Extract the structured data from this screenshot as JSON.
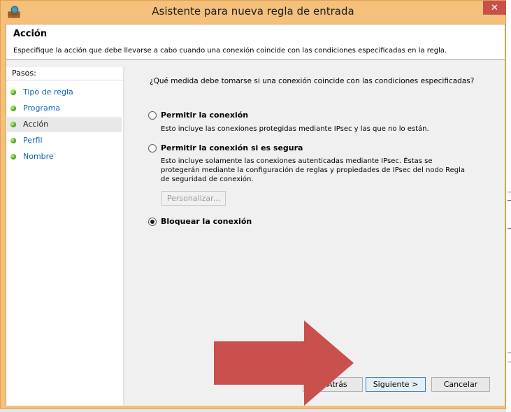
{
  "window": {
    "title": "Asistente para nueva regla de entrada",
    "close_glyph": "✕"
  },
  "header": {
    "title": "Acción",
    "description": "Especifique la acción que debe llevarse a cabo cuando una conexión coincide con las condiciones especificadas en la regla."
  },
  "steps": {
    "title": "Pasos:",
    "items": [
      {
        "label": "Tipo de regla",
        "current": false
      },
      {
        "label": "Programa",
        "current": false
      },
      {
        "label": "Acción",
        "current": true
      },
      {
        "label": "Perfil",
        "current": false
      },
      {
        "label": "Nombre",
        "current": false
      }
    ]
  },
  "main": {
    "question": "¿Qué medida debe tomarse si una conexión coincide con las condiciones especificadas?",
    "options": [
      {
        "label": "Permitir la conexión",
        "description": "Esto incluye las conexiones protegidas mediante IPsec y las que no lo están.",
        "selected": false
      },
      {
        "label": "Permitir la conexión si es segura",
        "description": "Esto incluye solamente las conexiones autenticadas mediante IPsec. Éstas se protegerán mediante la configuración de reglas y propiedades de IPsec del nodo Regla de seguridad de conexión.",
        "selected": false
      },
      {
        "label": "Bloquear la conexión",
        "description": "",
        "selected": true
      }
    ],
    "customize_button": "Personalizar..."
  },
  "footer": {
    "back_button": "< Atrás",
    "next_button": "Siguiente >",
    "cancel_button": "Cancelar"
  },
  "colors": {
    "arrow": "#c9504c",
    "title_bar": "#f4c07c",
    "step_link": "#1160b6",
    "close_button": "#c7514a"
  }
}
